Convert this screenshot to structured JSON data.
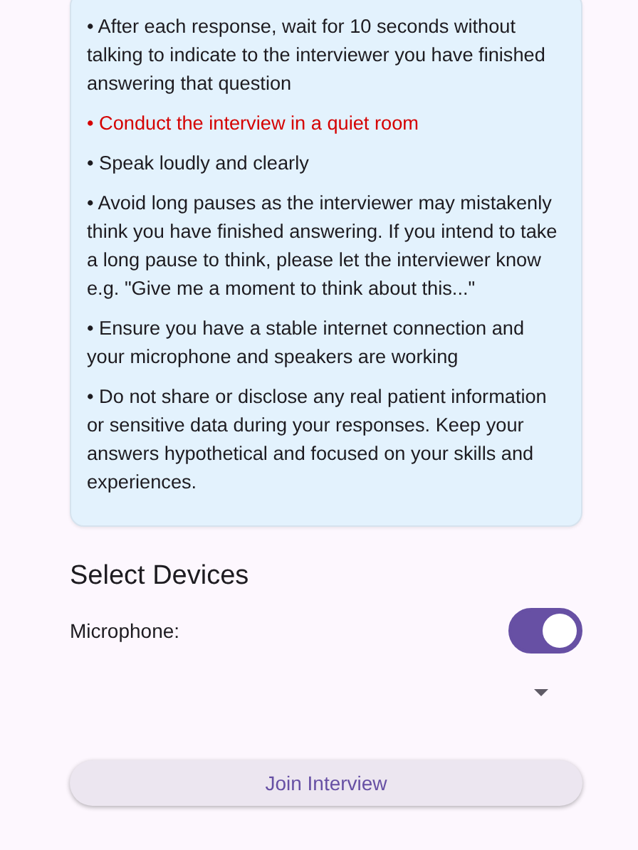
{
  "instructions": [
    {
      "kind": "normal",
      "text": "• After each response, wait for 10 seconds without talking to indicate to the interviewer you have finished answering that question"
    },
    {
      "kind": "warning",
      "text": "• Conduct the interview in a quiet room"
    },
    {
      "kind": "normal",
      "text": "• Speak loudly and clearly"
    },
    {
      "kind": "normal",
      "text": "• Avoid long pauses as the interviewer may mistakenly think you have finished answering. If you intend to take a long pause to think, please let the interviewer know e.g. \"Give me a moment to think about this...\""
    },
    {
      "kind": "normal",
      "text": "• Ensure you have a stable internet connection and your microphone and speakers are working"
    },
    {
      "kind": "normal",
      "text": "• Do not share or disclose any real patient information or sensitive data during your responses. Keep your answers hypothetical and focused on your skills and experiences."
    }
  ],
  "devices": {
    "heading": "Select Devices",
    "microphone": {
      "label": "Microphone:",
      "on": true
    }
  },
  "join_button": "Join Interview"
}
